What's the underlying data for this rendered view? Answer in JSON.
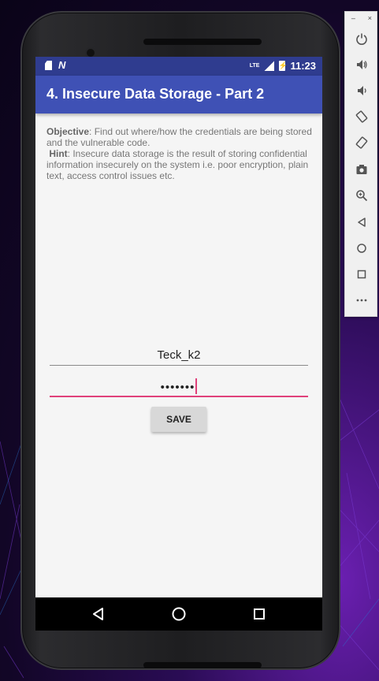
{
  "status_bar": {
    "network_type": "LTE",
    "time": "11:23"
  },
  "app_bar": {
    "title": "4. Insecure Data Storage - Part 2"
  },
  "description": {
    "objective_label": "Objective",
    "objective_text": ": Find out where/how the credentials are being stored and the vulnerable code.",
    "hint_label": "Hint",
    "hint_text": ": Insecure data storage is the result of storing confidential information insecurely on the system i.e. poor encryption, plain text, access control issues etc."
  },
  "form": {
    "username_value": "Teck_k2",
    "password_value": "•••••••",
    "save_label": "SAVE"
  },
  "colors": {
    "status_bar": "#2f3c8f",
    "app_bar": "#3f51b5",
    "accent": "#e0417a",
    "background": "#f5f5f5"
  },
  "navigation": {
    "back_icon": "back-triangle-icon",
    "home_icon": "home-circle-icon",
    "recents_icon": "recents-square-icon"
  },
  "emulator_toolbar": {
    "minimize": "–",
    "close": "×",
    "tools": [
      "power-icon",
      "volume-up-icon",
      "volume-down-icon",
      "rotate-left-icon",
      "rotate-right-icon",
      "camera-icon",
      "zoom-icon",
      "back-icon",
      "home-icon",
      "overview-icon",
      "more-icon"
    ]
  }
}
